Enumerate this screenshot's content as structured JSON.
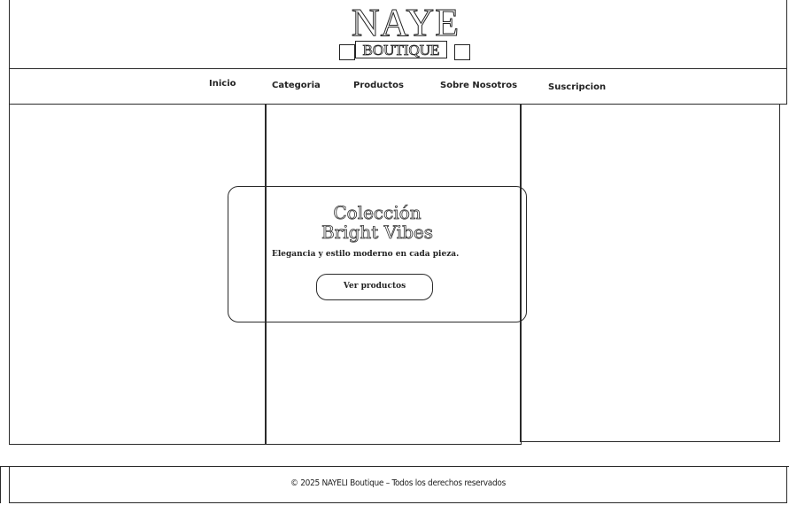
{
  "logo": {
    "main": "NAYE",
    "sub": "BOUTIQUE"
  },
  "nav": {
    "items": [
      {
        "label": "Inicio"
      },
      {
        "label": "Categoria"
      },
      {
        "label": "Productos"
      },
      {
        "label": "Sobre Nosotros"
      },
      {
        "label": "Suscripcion"
      }
    ]
  },
  "hero": {
    "title_line1": "Colección",
    "title_line2": "Bright Vibes",
    "subtitle": "Elegancia y estilo moderno en cada pieza.",
    "button_label": "Ver productos"
  },
  "footer": {
    "text": "© 2025 NAYELI Boutique – Todos los derechos reservados"
  }
}
